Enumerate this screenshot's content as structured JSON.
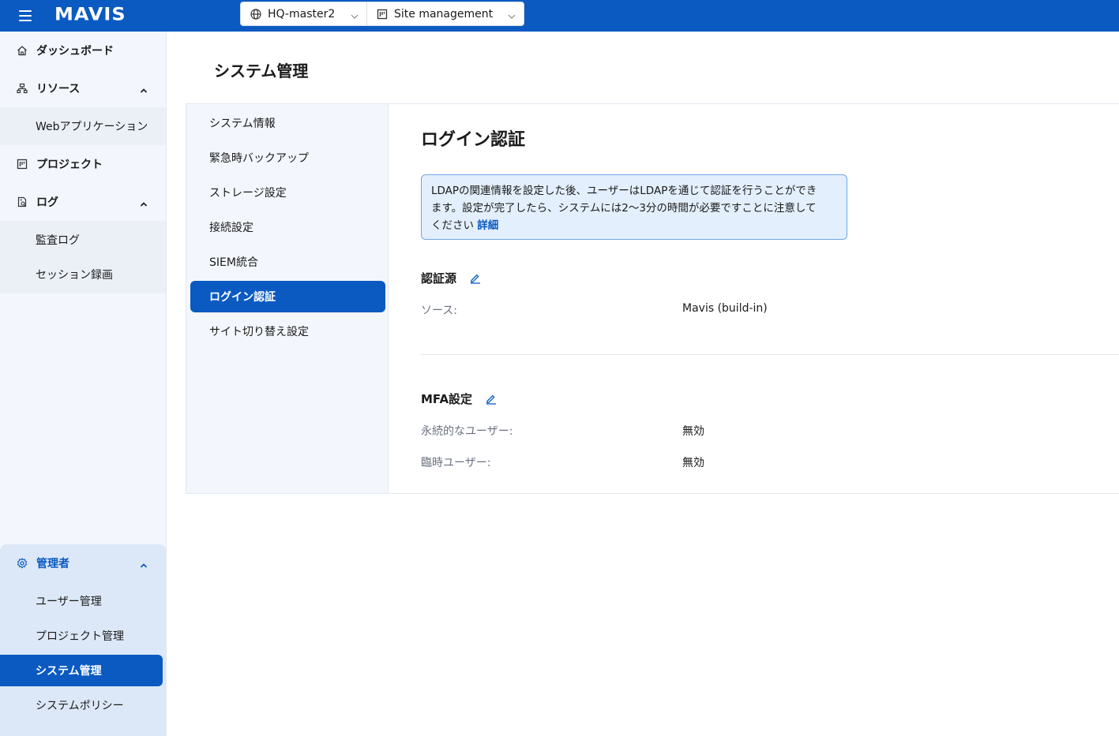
{
  "app": {
    "logo": "MAVIS",
    "host_selector": "HQ-master2",
    "site_selector": "Site management"
  },
  "sidebar": {
    "items": [
      {
        "label": "ダッシュボード",
        "icon": "home-icon"
      },
      {
        "label": "リソース",
        "icon": "sitemap-icon",
        "expanded": true,
        "children": [
          {
            "label": "Webアプリケーション"
          }
        ]
      },
      {
        "label": "プロジェクト",
        "icon": "project-board-icon"
      },
      {
        "label": "ログ",
        "icon": "log-file-icon",
        "expanded": true,
        "children": [
          {
            "label": "監査ログ"
          },
          {
            "label": "セッション録画"
          }
        ]
      }
    ],
    "admin": {
      "label": "管理者",
      "icon": "gear-icon",
      "children": [
        {
          "label": "ユーザー管理"
        },
        {
          "label": "プロジェクト管理"
        },
        {
          "label": "システム管理",
          "active": true
        },
        {
          "label": "システムポリシー"
        }
      ]
    }
  },
  "main": {
    "page_title": "システム管理",
    "subnav": [
      {
        "label": "システム情報"
      },
      {
        "label": "緊急時バックアップ"
      },
      {
        "label": "ストレージ設定"
      },
      {
        "label": "接続設定"
      },
      {
        "label": "SIEM統合"
      },
      {
        "label": "ログイン認証",
        "active": true
      },
      {
        "label": "サイト切り替え設定"
      }
    ],
    "content": {
      "title": "ログイン認証",
      "info_line1": "LDAPの関連情報を設定した後、ユーザーはLDAPを通じて認証を行うことができ",
      "info_line2": "ます。設定が完了したら、システムには2～3分の時間が必要ですことに注意して",
      "info_line3": "ください",
      "info_link": "詳細",
      "auth_source": {
        "title": "認証源",
        "source_label": "ソース:",
        "source_value": "Mavis (build-in)"
      },
      "mfa": {
        "title": "MFA設定",
        "permanent_label": "永続的なユーザー:",
        "permanent_value": "無効",
        "temporary_label": "臨時ユーザー:",
        "temporary_value": "無効"
      }
    }
  },
  "colors": {
    "brand": "#0a5ac2",
    "sidebar_bg": "#f3f7fd",
    "info_bg": "#e3effd"
  }
}
